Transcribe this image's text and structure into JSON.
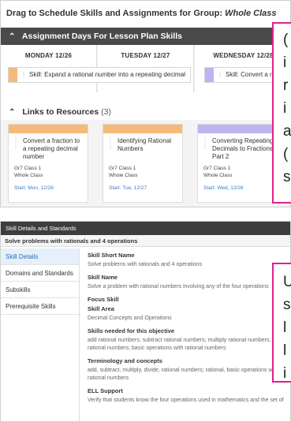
{
  "panel1": {
    "title_prefix": "Drag to Schedule Skills and Assignments for Group:",
    "title_group": "Whole Class",
    "section_title": "Assignment Days For Lesson Plan Skills",
    "days": [
      {
        "label": "MONDAY 12/26"
      },
      {
        "label": "TUESDAY 12/27"
      },
      {
        "label": "WEDNESDAY 12/28"
      }
    ],
    "skills": [
      {
        "text": "Skill: Expand a rational number into a repeating decimal",
        "color": "#f7b97a"
      },
      {
        "text": "Skill: Convert a repe",
        "color": "#bfb3f0"
      }
    ],
    "links": {
      "label": "Links to Resources",
      "count": "(3)"
    },
    "resources": [
      {
        "title": "Convert a fraction to a repeating decimal number",
        "class": "Gr7 Class 1",
        "group": "Whole Class",
        "start": "Start: Mon, 12/26",
        "color": "#f7b97a"
      },
      {
        "title": "Identifying Rational Numbers",
        "class": "Gr7 Class 1",
        "group": "Whole Class",
        "start": "Start: Tue, 12/27",
        "color": "#f7b97a"
      },
      {
        "title": "Converting Repeating Decimals to Fractions, Part 2",
        "class": "Gr7 Class 1",
        "group": "Whole Class",
        "start": "Start: Wed, 12/28",
        "color": "#bfb3f0"
      }
    ]
  },
  "panel2": {
    "topbar": "Skill Details and Standards",
    "subtitle": "Solve problems with rationals and 4 operations",
    "nav": [
      {
        "label": "Skill Details"
      },
      {
        "label": "Domains and Standards"
      },
      {
        "label": "Subskills"
      },
      {
        "label": "Prerequisite Skills"
      }
    ],
    "fields": {
      "short_name_label": "Skill Short Name",
      "short_name": "Solve problems with rationals and 4 operations",
      "name_label": "Skill Name",
      "name": "Solve a problem with rational numbers involving any of the four operations",
      "focus_label": "Focus Skill",
      "area_label": "Skill Area",
      "area": "Decimal Concepts and Operations",
      "needed_label": "Skills needed for this objective",
      "needed": "add rational numbers; subtract rational numbers; multiply rational numbers; divide rational numbers; basic operations with rational numbers",
      "terms_label": "Terminology and concepts",
      "terms": "add, subtract, multiply, divide, rational numbers; rational, basic operations with rational numbers",
      "ell_label": "ELL Support",
      "ell": "Verify that students know the four operations used in mathematics and the set of"
    }
  },
  "callouts": {
    "top_lines": [
      "(",
      "i",
      "r",
      "i",
      "a",
      "(",
      "s"
    ],
    "bottom_lines": [
      "U",
      "s",
      "l",
      "l",
      "i"
    ]
  },
  "colors": {
    "accent_pink": "#e0218a",
    "orange": "#f7b97a",
    "purple": "#bfb3f0",
    "link_blue": "#3a7cc8"
  }
}
